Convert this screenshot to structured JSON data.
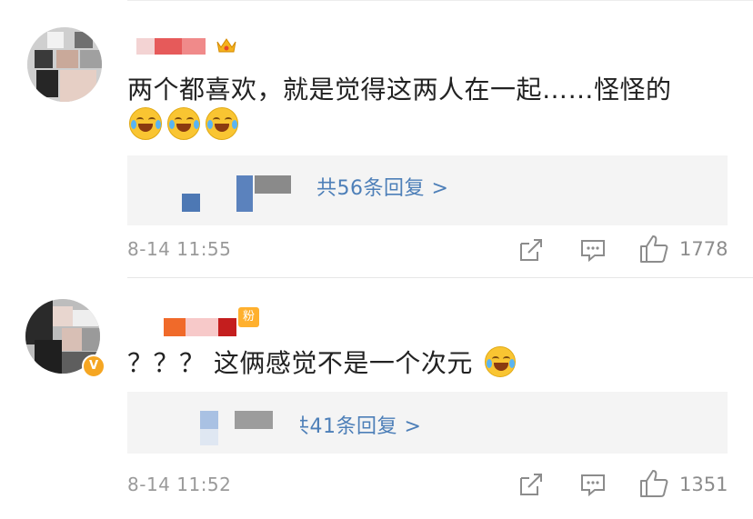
{
  "comments": [
    {
      "text": "两个都喜欢，就是觉得这两人在一起……怪怪的",
      "emojis": [
        "laugh-cry-emoji",
        "laugh-cry-emoji",
        "laugh-cry-emoji"
      ],
      "replies_label": "共56条回复 >",
      "timestamp": "8-14 11:55",
      "likes": "1778"
    },
    {
      "text": "？？？ 这俩感觉不是一个次元",
      "fan_badge": "粉",
      "replies_label": "共41条回复 >",
      "timestamp": "8-14 11:52",
      "likes": "1351"
    }
  ],
  "colors": {
    "link": "#4d7fb8",
    "meta": "#9a9a9a",
    "reply_bg": "#f4f4f4",
    "badge": "#f5a623"
  }
}
